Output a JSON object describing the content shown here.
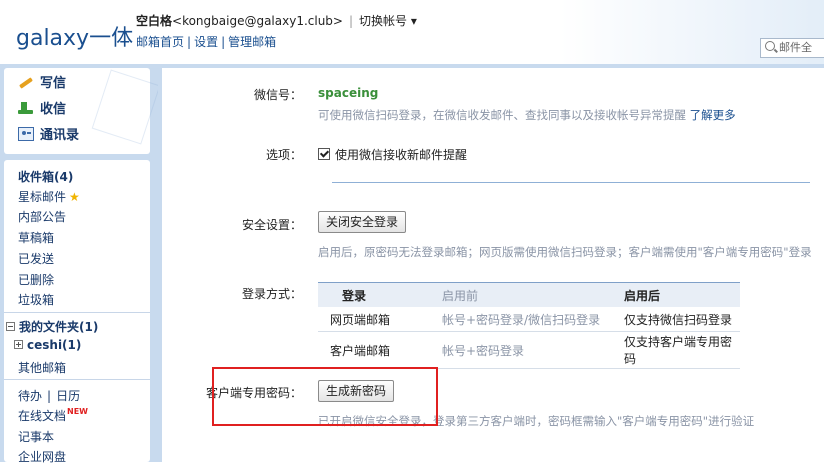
{
  "header": {
    "logo": "galaxy一体",
    "user_name": "空白格",
    "user_email": "<kongbaige@galaxy1.club>",
    "separator": "|",
    "switch_account": "切换帐号",
    "links": [
      "邮箱首页",
      "设置",
      "管理邮箱"
    ],
    "search_placeholder": "邮件全"
  },
  "sidebar": {
    "actions": [
      {
        "label": "写信",
        "icon": "pencil-icon"
      },
      {
        "label": "收信",
        "icon": "inbox-download-icon"
      },
      {
        "label": "通讯录",
        "icon": "contacts-icon"
      }
    ],
    "folders": [
      {
        "label": "收件箱(4)",
        "bold": true
      },
      {
        "label": "星标邮件"
      },
      {
        "label": "内部公告"
      },
      {
        "label": "草稿箱"
      },
      {
        "label": "已发送"
      },
      {
        "label": "已删除"
      },
      {
        "label": "垃圾箱"
      }
    ],
    "my_folders": "我的文件夹(1)",
    "sub_folder": "ceshi(1)",
    "other_mailboxes": "其他邮箱",
    "todo": "待办",
    "calendar": "日历",
    "online_docs": "在线文档",
    "new_badge": "NEW",
    "notes": "记事本",
    "enterprise": "企业网盘"
  },
  "settings": {
    "wechat_label": "微信号：",
    "wechat_id": "spaceing",
    "wechat_hint": "可使用微信扫码登录，在微信收发邮件、查找同事以及接收帐号异常提醒",
    "learn_more": "了解更多",
    "option_label": "选项：",
    "option_checkbox": "使用微信接收新邮件提醒",
    "option_checked": true,
    "security_label": "安全设置：",
    "security_button": "关闭安全登录",
    "security_hint": "启用后，原密码无法登录邮箱；网页版需使用微信扫码登录；客户端需使用\"客户端专用密码\"登录",
    "login_label": "登录方式：",
    "login_table": {
      "headers": [
        "登录",
        "启用前",
        "启用后"
      ],
      "rows": [
        [
          "网页端邮箱",
          "帐号+密码登录/微信扫码登录",
          "仅支持微信扫码登录"
        ],
        [
          "客户端邮箱",
          "帐号+密码登录",
          "仅支持客户端专用密码"
        ]
      ]
    },
    "client_pw_label": "客户端专用密码：",
    "client_pw_button": "生成新密码",
    "client_pw_hint": "已开启微信安全登录，登录第三方客户端时，密码框需输入\"客户端专用密码\"进行验证"
  },
  "colors": {
    "accent_blue": "#1a4f8f",
    "highlight_red": "#e02020",
    "wechat_green": "#3a8f3a",
    "sidebar_bg": "#c8daee"
  }
}
